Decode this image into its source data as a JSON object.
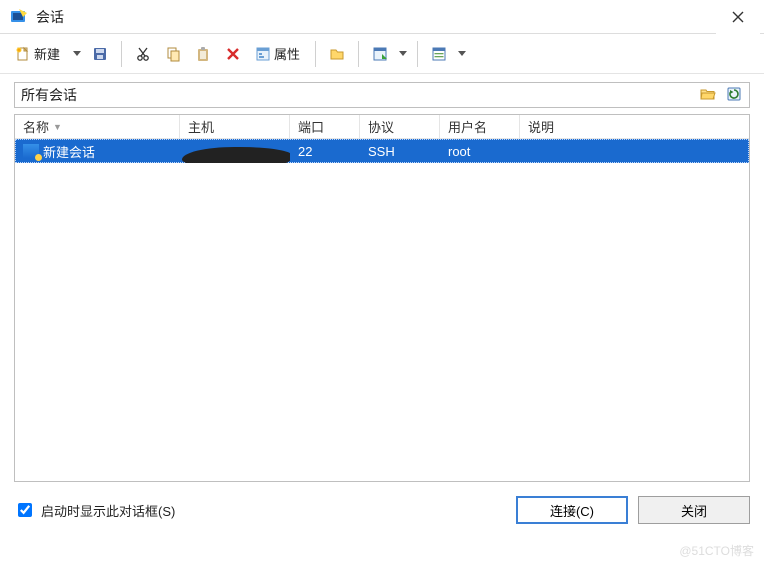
{
  "window": {
    "title": "会话"
  },
  "toolbar": {
    "new_label": "新建",
    "properties_label": "属性"
  },
  "path_bar": {
    "value": "所有会话"
  },
  "list": {
    "columns": {
      "name": "名称",
      "host": "主机",
      "port": "端口",
      "protocol": "协议",
      "user": "用户名",
      "description": "说明"
    },
    "sort_column": "name",
    "rows": [
      {
        "name": "新建会话",
        "host": "",
        "port": "22",
        "protocol": "SSH",
        "user": "root",
        "description": "",
        "selected": true,
        "host_redacted": true
      }
    ]
  },
  "footer": {
    "show_on_startup": "启动时显示此对话框(S)",
    "show_on_startup_checked": true,
    "connect": "连接(C)",
    "close": "关闭"
  },
  "watermark": "@51CTO博客"
}
